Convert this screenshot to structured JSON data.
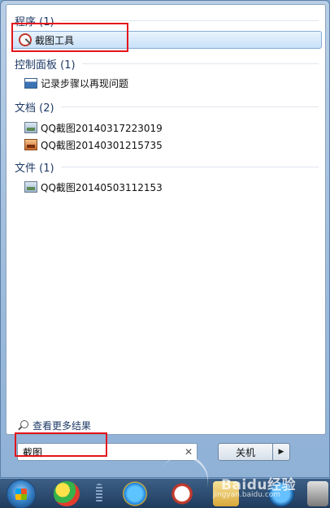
{
  "groups": [
    {
      "header": "程序 (1)",
      "items": [
        {
          "label": "截图工具",
          "icon": "snipping-tool-icon"
        }
      ]
    },
    {
      "header": "控制面板 (1)",
      "items": [
        {
          "label": "记录步骤以再现问题",
          "icon": "steps-recorder-icon"
        }
      ]
    },
    {
      "header": "文档 (2)",
      "items": [
        {
          "label": "QQ截图20140317223019",
          "icon": "image-file-icon"
        },
        {
          "label": "QQ截图20140301215735",
          "icon": "image-file-icon"
        }
      ]
    },
    {
      "header": "文件 (1)",
      "items": [
        {
          "label": "QQ截图20140503112153",
          "icon": "image-file-icon"
        }
      ]
    }
  ],
  "see_more": "查看更多结果",
  "search": {
    "value": "截图"
  },
  "shutdown": {
    "label": "关机"
  },
  "watermark": {
    "main": "Baidu经验",
    "sub": "jingyan.baidu.com"
  },
  "colors": {
    "highlight": "#e3151a",
    "selected_bg": "#c9e1f8"
  }
}
